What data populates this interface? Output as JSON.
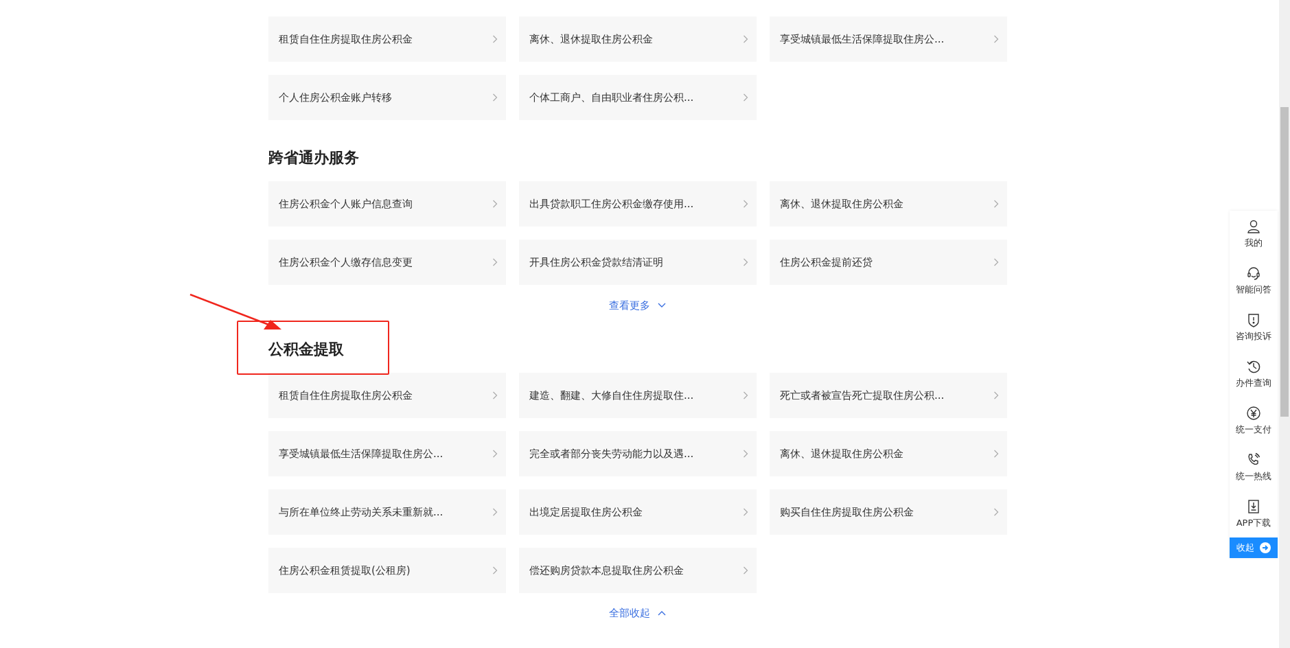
{
  "sections": [
    {
      "items": [
        "租赁自住住房提取住房公积金",
        "离休、退休提取住房公积金",
        "享受城镇最低生活保障提取住房公...",
        "个人住房公积金账户转移",
        "个体工商户、自由职业者住房公积..."
      ]
    },
    {
      "heading": "跨省通办服务",
      "items": [
        "住房公积金个人账户信息查询",
        "出具贷款职工住房公积金缴存使用...",
        "离休、退休提取住房公积金",
        "住房公积金个人缴存信息变更",
        "开具住房公积金贷款结清证明",
        "住房公积金提前还贷"
      ],
      "toggle": {
        "label": "查看更多",
        "expanded": false
      }
    },
    {
      "heading": "公积金提取",
      "highlighted": true,
      "items": [
        "租赁自住住房提取住房公积金",
        "建造、翻建、大修自住住房提取住...",
        "死亡或者被宣告死亡提取住房公积...",
        "享受城镇最低生活保障提取住房公...",
        "完全或者部分丧失劳动能力以及遇...",
        "离休、退休提取住房公积金",
        "与所在单位终止劳动关系未重新就...",
        "出境定居提取住房公积金",
        "购买自住住房提取住房公积金",
        "住房公积金租赁提取(公租房)",
        "偿还购房贷款本息提取住房公积金"
      ],
      "toggle": {
        "label": "全部收起",
        "expanded": true
      }
    }
  ],
  "sidebar": {
    "items": [
      {
        "kind": "user",
        "label": "我的"
      },
      {
        "kind": "headset",
        "label": "智能问答"
      },
      {
        "kind": "shield",
        "label": "咨询投诉"
      },
      {
        "kind": "history",
        "label": "办件查询"
      },
      {
        "kind": "yen",
        "label": "统一支付"
      },
      {
        "kind": "phone",
        "label": "统一热线"
      },
      {
        "kind": "download",
        "label": "APP下载"
      }
    ],
    "collapse_button": "收起"
  }
}
